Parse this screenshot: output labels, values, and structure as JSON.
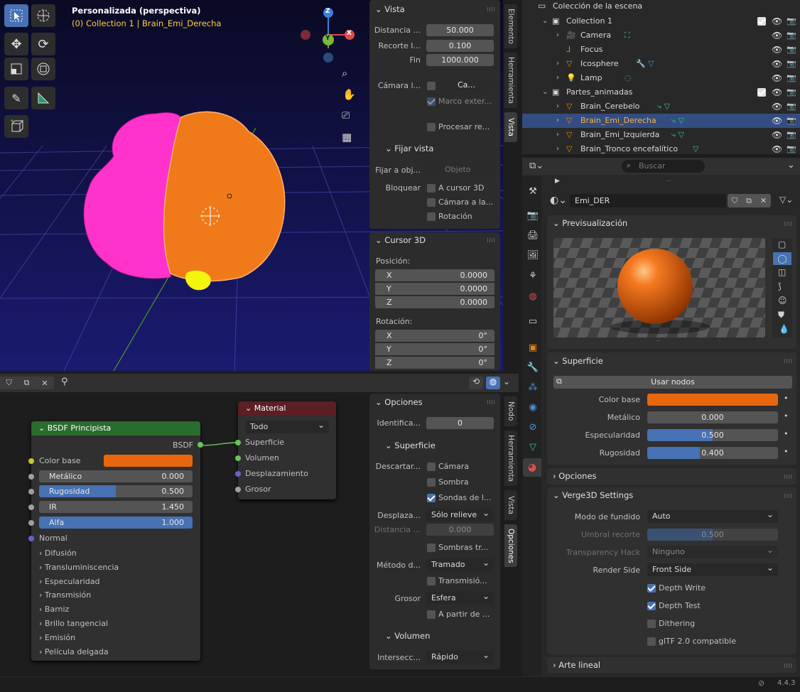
{
  "viewport": {
    "title": "Personalizada (perspectiva)",
    "subtitle": "(0) Collection 1 | Brain_Emi_Derecha",
    "axis_z": "Z",
    "axis_y": "Y",
    "axis_x": "X"
  },
  "vista": {
    "header": "Vista",
    "distancia_label": "Distancia ...",
    "distancia": "50.000",
    "recorte_label": "Recorte I...",
    "recorte": "0.100",
    "fin_label": "Fin",
    "fin": "1000.000",
    "camara_label": "Cámara l...",
    "camara_value": "Ca...",
    "marco_label": "Marco exter...",
    "procesar_label": "Procesar re...",
    "fijar_header": "Fijar vista",
    "fijar_label": "Fijar a obj...",
    "fijar_placeholder": "Objeto",
    "bloquear_label": "Bloquear",
    "lock_cursor": "A cursor 3D",
    "lock_camera": "Cámara a la...",
    "lock_rotacion": "Rotación"
  },
  "cursor3d": {
    "header": "Cursor 3D",
    "posicion_label": "Posición:",
    "px_label": "X",
    "px": "0.0000",
    "py_label": "Y",
    "py": "0.0000",
    "pz_label": "Z",
    "pz": "0.0000",
    "rotacion_label": "Rotación:",
    "rx_label": "X",
    "rx": "0°",
    "ry_label": "Y",
    "ry": "0°",
    "rz_label": "Z",
    "rz": "0°"
  },
  "viewport_tabs": [
    "Elemento",
    "Herramienta",
    "Vista"
  ],
  "outliner": {
    "title": "Colección de la escena",
    "rows": [
      {
        "label": "Collection 1",
        "indent": 0
      },
      {
        "label": "Camera",
        "indent": 1
      },
      {
        "label": "Focus",
        "indent": 1
      },
      {
        "label": "Icosphere",
        "indent": 1
      },
      {
        "label": "Lamp",
        "indent": 1
      },
      {
        "label": "Partes_animadas",
        "indent": 0
      },
      {
        "label": "Brain_Cerebelo",
        "indent": 1
      },
      {
        "label": "Brain_Emi_Derecha",
        "indent": 1
      },
      {
        "label": "Brain_Emi_Izquierda",
        "indent": 1
      },
      {
        "label": "Brain_Tronco encefalítico",
        "indent": 1
      }
    ]
  },
  "properties": {
    "search_placeholder": "Buscar",
    "material_name": "Emi_DER",
    "preview_header": "Previsualización",
    "surface_header": "Superficie",
    "use_nodes": "Usar nodos",
    "color_base_label": "Color base",
    "metalico_label": "Metálico",
    "metalico": "0.000",
    "especularidad_label": "Especularidad",
    "especularidad": "0.500",
    "rugosidad_label": "Rugosidad",
    "rugosidad": "0.400",
    "opciones_header": "Opciones",
    "verge_header": "Verge3D Settings",
    "modo_label": "Modo de fundido",
    "modo": "Auto",
    "umbral_label": "Umbral recorte",
    "umbral": "0.500",
    "transp_label": "Transparency Hack",
    "transp": "Ninguno",
    "render_side_label": "Render Side",
    "render_side": "Front Side",
    "depth_write": "Depth Write",
    "depth_test": "Depth Test",
    "dithering": "Dithering",
    "gltf": "glTF 2.0 compatible",
    "arte_header": "Arte lineal",
    "version": "4.4.3"
  },
  "nodes": {
    "bsdf_title": "BSDF Principista",
    "bsdf_out": "BSDF",
    "color_base": "Color base",
    "metalico_label": "Metálico",
    "metalico": "0.000",
    "rugosidad_label": "Rugosidad",
    "rugosidad": "0.500",
    "ir_label": "IR",
    "ir": "1.450",
    "alfa_label": "Alfa",
    "alfa": "1.000",
    "normal": "Normal",
    "sections": [
      "Difusión",
      "Transluminiscencia",
      "Especularidad",
      "Transmisión",
      "Barniz",
      "Brillo tangencial",
      "Emisión",
      "Película delgada"
    ],
    "material_title": "Material",
    "material_target": "Todo",
    "mat_superficie": "Superficie",
    "mat_volumen": "Volumen",
    "mat_desplazamiento": "Desplazamiento",
    "mat_grosor": "Grosor"
  },
  "node_sidebar": {
    "opciones_header": "Opciones",
    "ident_label": "Identifica...",
    "ident": "0",
    "superficie_header": "Superficie",
    "descartar_label": "Descartar...",
    "camara": "Cámara",
    "sombra": "Sombra",
    "sondas": "Sondas de l...",
    "desplaza_label": "Desplaza...",
    "desplaza": "Sólo relieve",
    "distancia_label": "Distancia ...",
    "distancia": "0.000",
    "sombras_tr": "Sombras tr...",
    "metodo_label": "Método d...",
    "metodo": "Tramado",
    "transmision": "Transmisió...",
    "grosor_label": "Grosor",
    "grosor": "Esfera",
    "apartir": "A partir de ...",
    "volumen_header": "Volumen",
    "intersec_label": "Intersecc...",
    "intersec": "Rápido"
  },
  "node_tabs": [
    "Nodo",
    "Herramienta",
    "Vista",
    "Opciones"
  ],
  "colors": {
    "accent": "#4772b3",
    "orange": "#e8670e",
    "magenta": "#ff33cc",
    "bg": "#1d1d1d",
    "panel": "#303030"
  }
}
